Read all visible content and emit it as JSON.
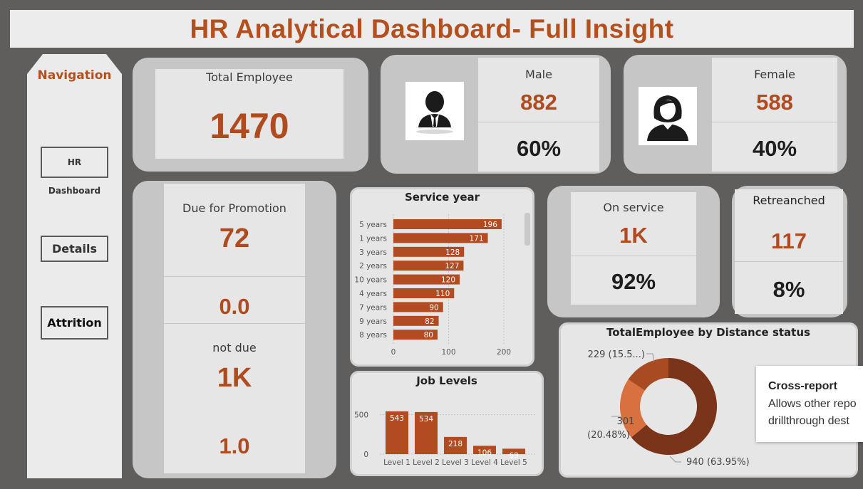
{
  "header": {
    "title": "HR Analytical Dashboard- Full Insight"
  },
  "navigation": {
    "title": "Navigation",
    "buttons": [
      "HR Dashboard",
      "Details",
      "Attrition"
    ]
  },
  "total_employee": {
    "label": "Total Employee",
    "value": "1470"
  },
  "male": {
    "label": "Male",
    "count": "882",
    "percent": "60%",
    "icon": "male-avatar-icon"
  },
  "female": {
    "label": "Female",
    "count": "588",
    "percent": "40%",
    "icon": "female-avatar-icon"
  },
  "promotion": {
    "label": "Due for Promotion",
    "value": "72",
    "ratio": "0.0",
    "not_due_label": "not due",
    "not_due_value": "1K",
    "not_due_ratio": "1.0"
  },
  "on_service": {
    "label": "On service",
    "value": "1K",
    "percent": "92%"
  },
  "retrenched": {
    "label": "Retreanched",
    "value": "117",
    "percent": "8%"
  },
  "tooltip": {
    "title": "Cross-report",
    "body": "Allows other repo drillthrough dest"
  },
  "colors": {
    "accent": "#b4501e",
    "bar": "#b24b22",
    "donut": [
      "#7a3419",
      "#d9703f",
      "#a84a22"
    ]
  },
  "chart_data": [
    {
      "type": "bar",
      "orientation": "horizontal",
      "title": "Service year",
      "categories": [
        "5 years",
        "1 years",
        "3 years",
        "2 years",
        "10 years",
        "4 years",
        "7 years",
        "9 years",
        "8 years"
      ],
      "values": [
        196,
        171,
        128,
        127,
        120,
        110,
        90,
        82,
        80
      ],
      "xticks": [
        "0",
        "100",
        "200"
      ],
      "xlim": [
        0,
        200
      ],
      "grid": true
    },
    {
      "type": "bar",
      "title": "Job Levels",
      "categories": [
        "Level 1",
        "Level 2",
        "Level 3",
        "Level 4",
        "Level 5"
      ],
      "values": [
        543,
        534,
        218,
        106,
        69
      ],
      "yticks": [
        "0",
        "500"
      ],
      "ylim": [
        0,
        560
      ]
    },
    {
      "type": "pie",
      "donut": true,
      "title": "TotalEmployee by Distance status",
      "values": [
        940,
        301,
        229
      ],
      "labels": [
        "940 (63.95%)",
        "301 (20.48%)",
        "229 (15.5...)"
      ]
    }
  ]
}
